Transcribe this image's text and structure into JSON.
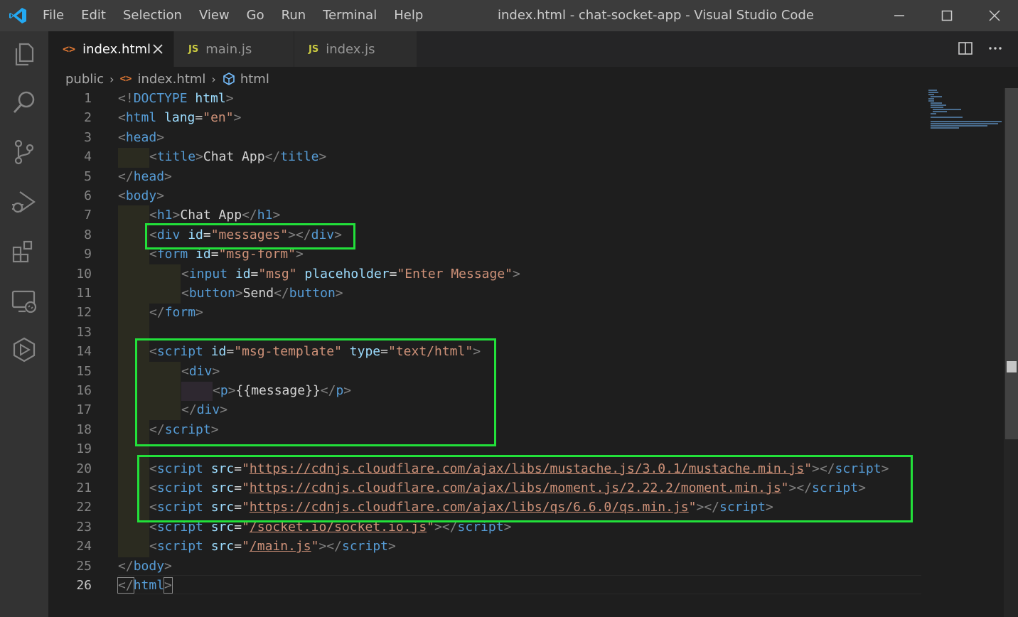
{
  "window": {
    "title": "index.html - chat-socket-app - Visual Studio Code"
  },
  "menu": [
    "File",
    "Edit",
    "Selection",
    "View",
    "Go",
    "Run",
    "Terminal",
    "Help"
  ],
  "activity_bar": [
    "files-icon",
    "search-icon",
    "source-control-icon",
    "run-debug-icon",
    "extensions-icon",
    "remote-explorer-icon",
    "live-share-icon"
  ],
  "tabs": [
    {
      "label": "index.html",
      "icon": "<>",
      "active": true
    },
    {
      "label": "main.js",
      "icon": "JS",
      "active": false
    },
    {
      "label": "index.js",
      "icon": "JS",
      "active": false
    }
  ],
  "breadcrumb": {
    "folder": "public",
    "file": "index.html",
    "file_icon": "<>",
    "symbol": "html"
  },
  "editor": {
    "current_line": "26",
    "line_numbers": [
      "1",
      "2",
      "3",
      "4",
      "5",
      "6",
      "7",
      "8",
      "9",
      "10",
      "11",
      "12",
      "13",
      "14",
      "15",
      "16",
      "17",
      "18",
      "19",
      "20",
      "21",
      "22",
      "23",
      "24",
      "25",
      "26"
    ],
    "code": {
      "l1": [
        "<!",
        "DOCTYPE",
        " html",
        ">"
      ],
      "l2": [
        "<",
        "html",
        " lang",
        "=",
        "\"en\"",
        ">"
      ],
      "l3": [
        "<",
        "head",
        ">"
      ],
      "l4": [
        "<",
        "title",
        ">",
        "Chat App",
        "</",
        "title",
        ">"
      ],
      "l5": [
        "</",
        "head",
        ">"
      ],
      "l6": [
        "<",
        "body",
        ">"
      ],
      "l7": [
        "<",
        "h1",
        ">",
        "Chat App",
        "</",
        "h1",
        ">"
      ],
      "l8": [
        "<",
        "div",
        " id",
        "=",
        "\"messages\"",
        "></",
        "div",
        ">"
      ],
      "l9": [
        "<",
        "form",
        " id",
        "=",
        "\"msg-form\"",
        ">"
      ],
      "l10": [
        "<",
        "input",
        " id",
        "=",
        "\"msg\"",
        " placeholder",
        "=",
        "\"Enter Message\"",
        ">"
      ],
      "l11": [
        "<",
        "button",
        ">",
        "Send",
        "</",
        "button",
        ">"
      ],
      "l12": [
        "</",
        "form",
        ">"
      ],
      "l14": [
        "<",
        "script",
        " id",
        "=",
        "\"msg-template\"",
        " type",
        "=",
        "\"text/html\"",
        ">"
      ],
      "l15": [
        "<",
        "div",
        ">"
      ],
      "l16": [
        "<",
        "p",
        ">",
        "{{message}}",
        "</",
        "p",
        ">"
      ],
      "l17": [
        "</",
        "div",
        ">"
      ],
      "l18": [
        "</",
        "script",
        ">"
      ],
      "l20": [
        "<",
        "script",
        " src",
        "=",
        "\"",
        "https://cdnjs.cloudflare.com/ajax/libs/mustache.js/3.0.1/mustache.min.js",
        "\"",
        "></",
        "script",
        ">"
      ],
      "l21": [
        "<",
        "script",
        " src",
        "=",
        "\"",
        "https://cdnjs.cloudflare.com/ajax/libs/moment.js/2.22.2/moment.min.js",
        "\"",
        "></",
        "script",
        ">"
      ],
      "l22": [
        "<",
        "script",
        " src",
        "=",
        "\"",
        "https://cdnjs.cloudflare.com/ajax/libs/qs/6.6.0/qs.min.js",
        "\"",
        "></",
        "script",
        ">"
      ],
      "l23": [
        "<",
        "script",
        " src",
        "=",
        "\"",
        "/socket.io/socket.io.js",
        "\"",
        "></",
        "script",
        ">"
      ],
      "l24": [
        "<",
        "script",
        " src",
        "=",
        "\"",
        "/main.js",
        "\"",
        "></",
        "script",
        ">"
      ],
      "l25": [
        "</",
        "body",
        ">"
      ],
      "l26": [
        "</",
        "html",
        ">"
      ]
    }
  },
  "colors": {
    "highlight_box": "#22e03a",
    "tag": "#569cd6",
    "attribute": "#9cdcfe",
    "string": "#ce9178"
  }
}
